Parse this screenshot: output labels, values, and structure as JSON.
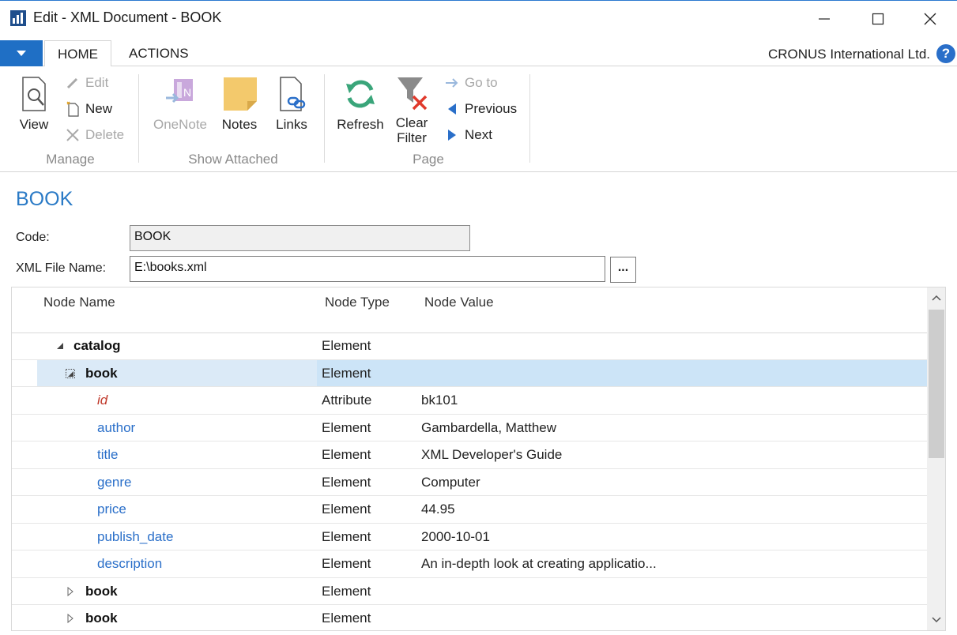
{
  "window": {
    "title": "Edit - XML Document - BOOK"
  },
  "ribbon": {
    "tabs": [
      {
        "label": "HOME"
      },
      {
        "label": "ACTIONS"
      }
    ],
    "company": "CRONUS International Ltd.",
    "help": "?",
    "groups": {
      "manage": {
        "label": "Manage",
        "view": "View",
        "edit": "Edit",
        "new": "New",
        "delete": "Delete"
      },
      "show_attached": {
        "label": "Show Attached",
        "onenote": "OneNote",
        "notes": "Notes",
        "links": "Links"
      },
      "page": {
        "label": "Page",
        "refresh": "Refresh",
        "clear_filter_1": "Clear",
        "clear_filter_2": "Filter",
        "goto": "Go to",
        "previous": "Previous",
        "next": "Next"
      }
    }
  },
  "page": {
    "title": "BOOK",
    "fields": {
      "code_label": "Code:",
      "code_value": "BOOK",
      "xml_file_label": "XML File Name:",
      "xml_file_value": "E:\\books.xml",
      "assist": "..."
    }
  },
  "grid": {
    "columns": {
      "node_name": "Node Name",
      "node_type": "Node Type",
      "node_value": "Node Value"
    },
    "rows": [
      {
        "name": "catalog",
        "type": "Element",
        "value": "",
        "style": "bold",
        "indent": 0,
        "toggle": "expanded"
      },
      {
        "name": "book",
        "type": "Element",
        "value": "",
        "style": "bold",
        "indent": 1,
        "toggle": "selected"
      },
      {
        "name": "id",
        "type": "Attribute",
        "value": "bk101",
        "style": "attr",
        "indent": 2,
        "toggle": "none"
      },
      {
        "name": "author",
        "type": "Element",
        "value": "Gambardella, Matthew",
        "style": "child",
        "indent": 2,
        "toggle": "none"
      },
      {
        "name": "title",
        "type": "Element",
        "value": "XML Developer's Guide",
        "style": "child",
        "indent": 2,
        "toggle": "none"
      },
      {
        "name": "genre",
        "type": "Element",
        "value": "Computer",
        "style": "child",
        "indent": 2,
        "toggle": "none"
      },
      {
        "name": "price",
        "type": "Element",
        "value": "44.95",
        "style": "child",
        "indent": 2,
        "toggle": "none"
      },
      {
        "name": "publish_date",
        "type": "Element",
        "value": "2000-10-01",
        "style": "child",
        "indent": 2,
        "toggle": "none"
      },
      {
        "name": "description",
        "type": "Element",
        "value": "An in-depth look at creating applicatio...",
        "style": "child",
        "indent": 2,
        "toggle": "none"
      },
      {
        "name": "book",
        "type": "Element",
        "value": "",
        "style": "bold",
        "indent": 1,
        "toggle": "collapsed"
      },
      {
        "name": "book",
        "type": "Element",
        "value": "",
        "style": "bold",
        "indent": 1,
        "toggle": "collapsed"
      }
    ]
  },
  "colors": {
    "accent": "#2a7ac6",
    "selection": "#cce4f7",
    "attribute": "#c0392b",
    "child_node": "#2a6fc9"
  }
}
